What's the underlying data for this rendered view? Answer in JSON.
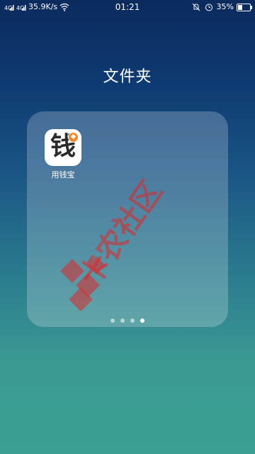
{
  "status_bar": {
    "network_speed": "35.9K/s",
    "time": "01:21",
    "battery": "35%",
    "battery_level": 0.35
  },
  "folder": {
    "title": "文件夹",
    "apps": [
      {
        "label": "用钱宝",
        "icon_glyph": "钱",
        "icon": "yongqianbao-icon"
      }
    ],
    "pages": 4,
    "active_page": 3
  },
  "watermark": {
    "text": "卡农社区"
  }
}
